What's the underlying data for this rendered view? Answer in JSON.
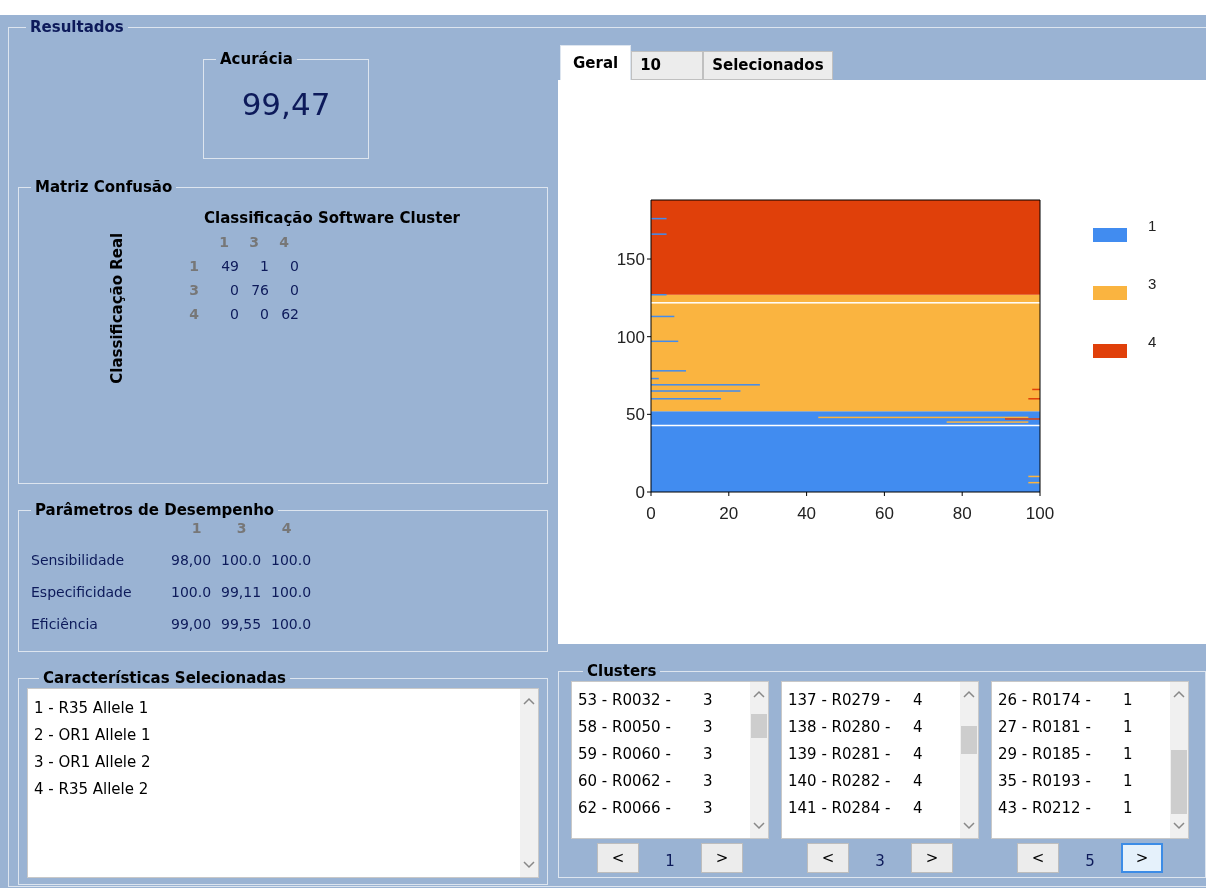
{
  "section_title": "Resultados",
  "accuracy": {
    "title": "Acurácia",
    "value": "99,47"
  },
  "confusion_matrix": {
    "title": "Matriz Confusão",
    "column_title": "Classificação Software Cluster",
    "row_title": "Classificação Real",
    "column_headers": [
      "1",
      "3",
      "4"
    ],
    "rows": [
      {
        "header": "1",
        "values": [
          "49",
          "1",
          "0"
        ]
      },
      {
        "header": "3",
        "values": [
          "0",
          "76",
          "0"
        ]
      },
      {
        "header": "4",
        "values": [
          "0",
          "0",
          "62"
        ]
      }
    ]
  },
  "performance": {
    "title": "Parâmetros de Desempenho",
    "column_headers": [
      "1",
      "3",
      "4"
    ],
    "rows": [
      {
        "label": "Sensibilidade",
        "values": [
          "98,00",
          "100.0",
          "100.0"
        ]
      },
      {
        "label": "Especificidade",
        "values": [
          "100.0",
          "99,11",
          "100.0"
        ]
      },
      {
        "label": "Eficiência",
        "values": [
          "99,00",
          "99,55",
          "100.0"
        ]
      }
    ]
  },
  "selected_features": {
    "title": "Características Selecionadas",
    "items": [
      "1 - R35 Allele 1",
      "2 - OR1 Allele 1",
      "3 - OR1 Allele 2",
      "4 - R35 Allele 2"
    ]
  },
  "tabs": [
    {
      "label": "Geral",
      "selected": true
    },
    {
      "label": "10",
      "selected": false
    },
    {
      "label": "Selecionados",
      "selected": false
    }
  ],
  "chart": {
    "y_ticks": [
      "150",
      "100",
      "50",
      "0"
    ],
    "x_ticks": [
      "0",
      "20",
      "40",
      "60",
      "80",
      "100"
    ],
    "legend": [
      {
        "label": "1",
        "color": "#418cf0"
      },
      {
        "label": "3",
        "color": "#fab440"
      },
      {
        "label": "4",
        "color": "#e0400a"
      }
    ]
  },
  "clusters": {
    "title": "Clusters",
    "lists": [
      {
        "items": [
          {
            "label": "53 - R0032 -",
            "cluster": "3"
          },
          {
            "label": "58 - R0050 -",
            "cluster": "3"
          },
          {
            "label": "59 - R0060 -",
            "cluster": "3"
          },
          {
            "label": "60 - R0062 -",
            "cluster": "3"
          },
          {
            "label": "62 - R0066 -",
            "cluster": "3"
          }
        ],
        "prev": "<",
        "page": "1",
        "next": ">",
        "next_focused": false
      },
      {
        "items": [
          {
            "label": "137 - R0279 -",
            "cluster": "4"
          },
          {
            "label": "138 - R0280 -",
            "cluster": "4"
          },
          {
            "label": "139 - R0281 -",
            "cluster": "4"
          },
          {
            "label": "140 - R0282 -",
            "cluster": "4"
          },
          {
            "label": "141 - R0284 -",
            "cluster": "4"
          }
        ],
        "prev": "<",
        "page": "3",
        "next": ">",
        "next_focused": false
      },
      {
        "items": [
          {
            "label": "26 - R0174 -",
            "cluster": "1"
          },
          {
            "label": "27 - R0181 -",
            "cluster": "1"
          },
          {
            "label": "29 - R0185 -",
            "cluster": "1"
          },
          {
            "label": "35 - R0193 -",
            "cluster": "1"
          },
          {
            "label": "43 - R0212 -",
            "cluster": "1"
          }
        ],
        "prev": "<",
        "page": "5",
        "next": ">",
        "next_focused": true
      }
    ]
  }
}
